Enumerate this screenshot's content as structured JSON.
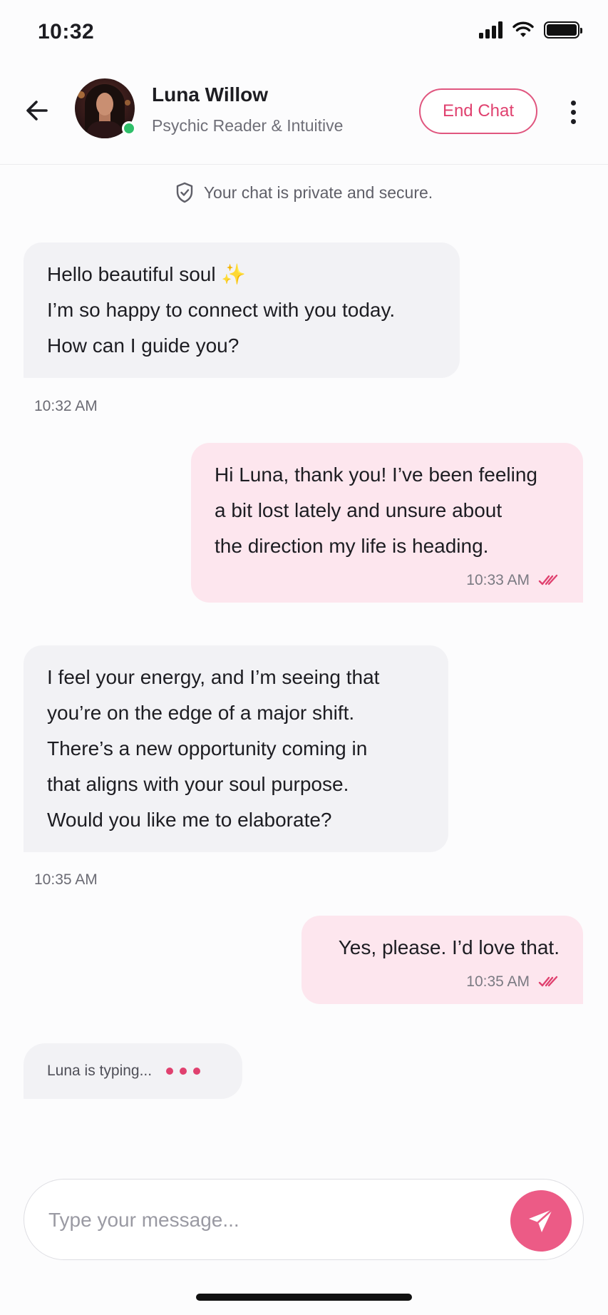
{
  "status_bar": {
    "time": "10:32"
  },
  "header": {
    "contact_name": "Luna Willow",
    "contact_role": "Psychic Reader & Intuitive",
    "end_chat_label": "End Chat",
    "online_color": "#2fbf6a"
  },
  "privacy_note": "Your chat is private and secure.",
  "messages": [
    {
      "direction": "incoming",
      "lines": [
        "Hello beautiful soul ✨",
        "I’m so happy to connect with you today.",
        "How can I guide you?"
      ],
      "time": "10:32 AM"
    },
    {
      "direction": "outgoing",
      "lines": [
        "Hi Luna, thank you! I’ve been feeling",
        "a bit lost lately and unsure about",
        "the direction my life is heading."
      ],
      "time": "10:33 AM",
      "read": true
    },
    {
      "direction": "incoming",
      "lines": [
        "I feel your energy, and I’m seeing that",
        "you’re on the edge of a major shift.",
        "There’s a new opportunity coming in",
        "that aligns with your soul purpose.",
        "Would you like me to elaborate?"
      ],
      "time": "10:35 AM"
    },
    {
      "direction": "outgoing",
      "lines": [
        "Yes, please. I’d love that."
      ],
      "time": "10:35 AM",
      "read": true
    }
  ],
  "typing_indicator": "Luna is typing...",
  "composer": {
    "placeholder": "Type your message..."
  },
  "colors": {
    "accent": "#e0416f",
    "send_button": "#ec5b86",
    "outgoing_bubble": "#fde6ee",
    "incoming_bubble": "#f2f2f5"
  }
}
